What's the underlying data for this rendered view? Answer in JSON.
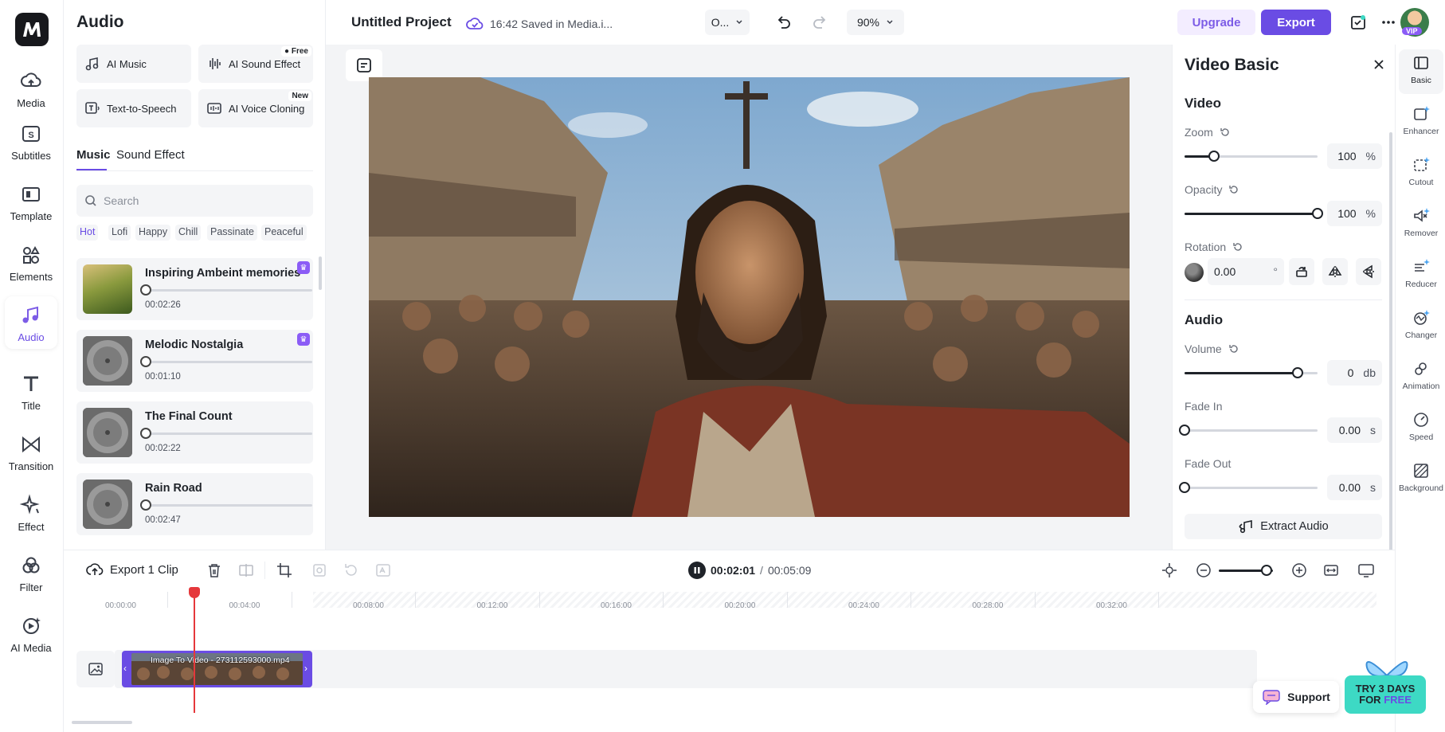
{
  "rail": {
    "items": [
      {
        "label": "Media",
        "icon": "cloud-upload-icon"
      },
      {
        "label": "Subtitles",
        "icon": "subtitles-icon"
      },
      {
        "label": "Template",
        "icon": "template-icon"
      },
      {
        "label": "Elements",
        "icon": "elements-icon"
      },
      {
        "label": "Audio",
        "icon": "music-note-icon",
        "active": true
      },
      {
        "label": "Title",
        "icon": "title-t-icon"
      },
      {
        "label": "Transition",
        "icon": "transition-icon"
      },
      {
        "label": "Effect",
        "icon": "sparkle-icon"
      },
      {
        "label": "Filter",
        "icon": "filter-icon"
      },
      {
        "label": "AI Media",
        "icon": "ai-media-icon"
      }
    ]
  },
  "panel": {
    "title": "Audio",
    "tools": [
      {
        "label": "AI Music",
        "icon": "ai-music-icon"
      },
      {
        "label": "AI Sound Effect",
        "icon": "waveform-icon",
        "tag": "Free"
      },
      {
        "label": "Text-to-Speech",
        "icon": "text-to-speech-icon"
      },
      {
        "label": "AI Voice Cloning",
        "icon": "voice-cloning-icon",
        "tag": "New"
      }
    ],
    "tabs": [
      {
        "label": "Music",
        "active": true
      },
      {
        "label": "Sound Effect"
      }
    ],
    "search": {
      "placeholder": "Search"
    },
    "chips": [
      "Hot",
      "Lofi",
      "Happy",
      "Chill",
      "Passinate",
      "Peaceful"
    ],
    "tracks": [
      {
        "name": "Inspiring Ambeint memories",
        "duration": "00:02:26",
        "premium": true
      },
      {
        "name": "Melodic Nostalgia",
        "duration": "00:01:10",
        "premium": true
      },
      {
        "name": "The Final Count",
        "duration": "00:02:22",
        "premium": false
      },
      {
        "name": "Rain Road",
        "duration": "00:02:47",
        "premium": false
      }
    ]
  },
  "topbar": {
    "project_title": "Untitled Project",
    "save_status": "16:42 Saved in Media.i...",
    "ratio_select": "O...",
    "zoom": "90%",
    "upgrade_label": "Upgrade",
    "export_label": "Export",
    "vip_badge": "VIP"
  },
  "props": {
    "title": "Video Basic",
    "video_section": "Video",
    "zoom": {
      "label": "Zoom",
      "value": "100",
      "unit": "%",
      "level": 0.22
    },
    "opacity": {
      "label": "Opacity",
      "value": "100",
      "unit": "%",
      "level": 1.0
    },
    "rotation": {
      "label": "Rotation",
      "value": "0.00",
      "unit": "°"
    },
    "audio_section": "Audio",
    "volume": {
      "label": "Volume",
      "value": "0",
      "unit": "db",
      "level": 0.85
    },
    "fade_in": {
      "label": "Fade In",
      "value": "0.00",
      "unit": "s",
      "level": 0
    },
    "fade_out": {
      "label": "Fade Out",
      "value": "0.00",
      "unit": "s",
      "level": 0
    },
    "extract_label": "Extract Audio"
  },
  "tool_rail": {
    "items": [
      {
        "label": "Basic",
        "icon": "basic-icon",
        "active": true
      },
      {
        "label": "Enhancer",
        "icon": "enhancer-icon"
      },
      {
        "label": "Cutout",
        "icon": "cutout-icon"
      },
      {
        "label": "Remover",
        "icon": "remover-icon"
      },
      {
        "label": "Reducer",
        "icon": "reducer-icon"
      },
      {
        "label": "Changer",
        "icon": "changer-icon"
      },
      {
        "label": "Animation",
        "icon": "animation-icon"
      },
      {
        "label": "Speed",
        "icon": "speed-icon"
      },
      {
        "label": "Background",
        "icon": "background-icon"
      }
    ]
  },
  "timeline": {
    "export_clip_label": "Export 1 Clip",
    "current_time": "00:02:01",
    "separator": "/",
    "total_time": "00:05:09",
    "ruler_ticks": [
      "00:00:00",
      "00:04:00",
      "00:08:00",
      "00:12:00",
      "00:16:00",
      "00:20:00",
      "00:24:00",
      "00:28:00",
      "00:32:00"
    ],
    "clip_label": "Image To Video - 273112593000.mp4"
  },
  "support_label": "Support",
  "promo": {
    "line1": "TRY 3 DAYS",
    "line2_a": "FOR ",
    "line2_b": "FREE"
  },
  "colors": {
    "accent": "#6a4ce4",
    "playhead": "#e5383b",
    "promo": "#3dd9c4"
  }
}
